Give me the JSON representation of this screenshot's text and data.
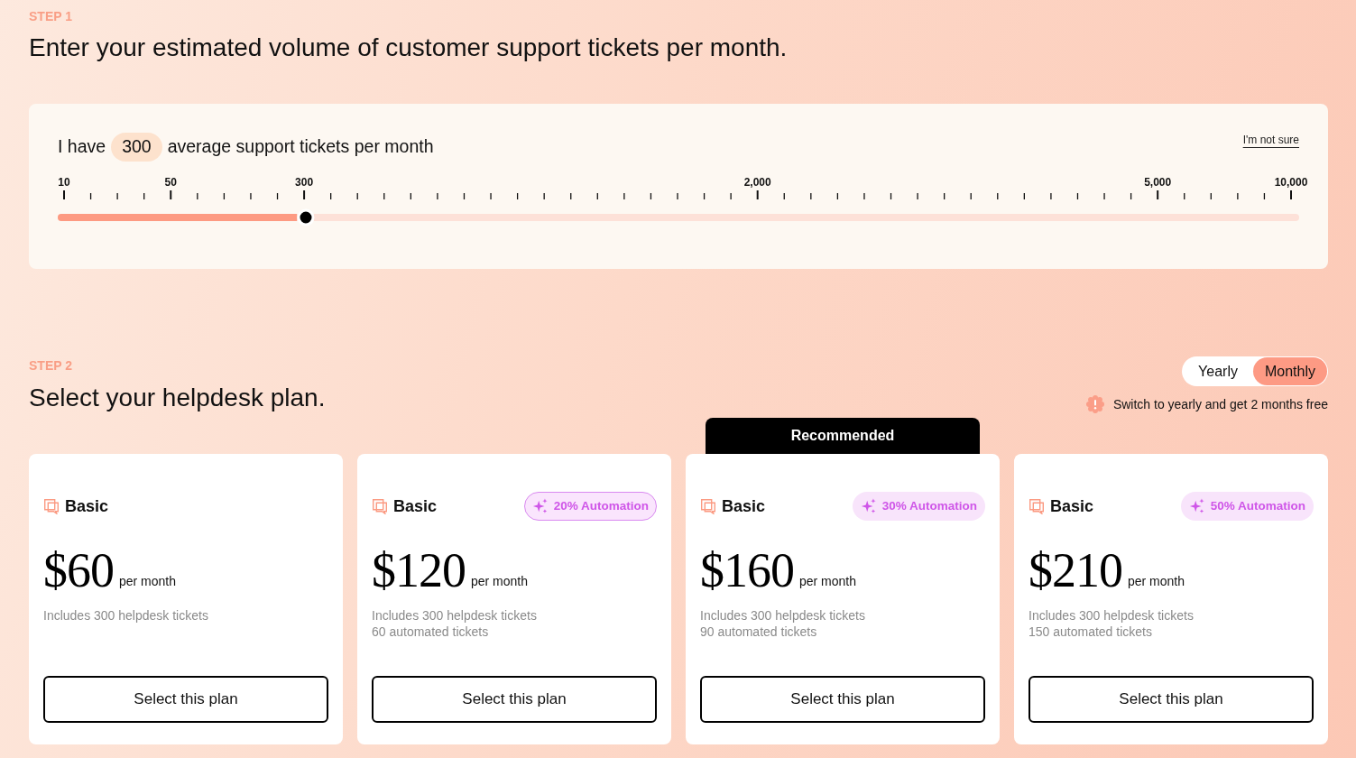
{
  "step1": {
    "step_label": "STEP 1",
    "heading": "Enter your estimated volume of customer support tickets per month.",
    "volume_card": {
      "sentence_before": "I have",
      "value": "300",
      "sentence_after": "average support tickets per month",
      "help_link": "I'm not sure",
      "slider": {
        "scale_labels": [
          "10",
          "50",
          "300",
          "2,000",
          "5,000",
          "10,000"
        ],
        "level": 0.2
      }
    }
  },
  "step2": {
    "step_label": "STEP 2",
    "heading": "Select your helpdesk plan.",
    "billing_toggle": [
      {
        "label": "Yearly",
        "selected": false
      },
      {
        "label": "Monthly",
        "selected": true
      }
    ],
    "billing_note": "Switch to yearly and get 2 months free",
    "plans": [
      {
        "name": "Basic",
        "price": "$60",
        "period": "per month",
        "details": [
          "Includes 300 helpdesk tickets"
        ],
        "button": "Select this plan"
      },
      {
        "name": "Basic",
        "badge": {
          "label": "20% Automation",
          "outlined": true
        },
        "price": "$120",
        "period": "per month",
        "details": [
          "Includes 300 helpdesk tickets",
          "60 automated tickets"
        ],
        "button": "Select this plan"
      },
      {
        "ribbon": "Recommended",
        "name": "Basic",
        "badge": {
          "label": "30% Automation",
          "outlined": false
        },
        "price": "$160",
        "period": "per month",
        "details": [
          "Includes 300 helpdesk tickets",
          "90 automated tickets"
        ],
        "button": "Select this plan"
      },
      {
        "name": "Basic",
        "badge": {
          "label": "50% Automation",
          "outlined": false
        },
        "price": "$210",
        "period": "per month",
        "details": [
          "Includes 300 helpdesk tickets",
          "150 automated tickets"
        ],
        "button": "Select this plan"
      }
    ]
  }
}
